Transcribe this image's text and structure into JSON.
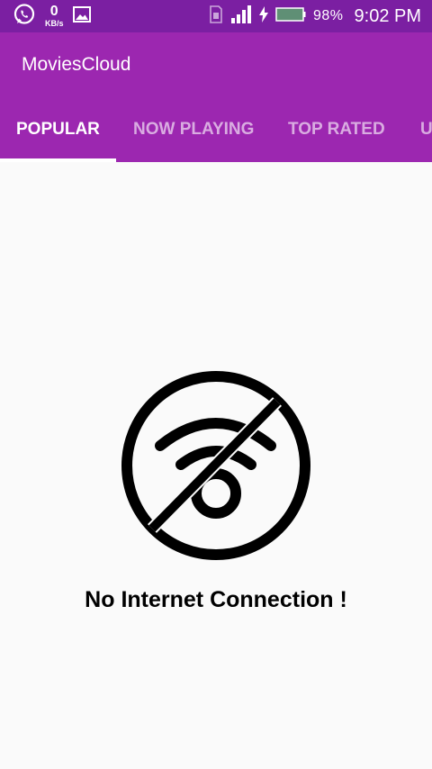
{
  "status_bar": {
    "data_rate": "0",
    "data_rate_unit": "KB/s",
    "battery_percent": "98%",
    "time": "9:02 PM",
    "icons": [
      "whatsapp-icon",
      "image-icon",
      "sim-icon",
      "signal-icon",
      "charging-icon",
      "battery-icon"
    ]
  },
  "app_bar": {
    "title": "MoviesCloud",
    "background": "#9c27b0"
  },
  "tabs": [
    {
      "label": "POPULAR",
      "active": true
    },
    {
      "label": "NOW PLAYING",
      "active": false
    },
    {
      "label": "TOP RATED",
      "active": false
    },
    {
      "label": "UPCOMING",
      "active": false
    }
  ],
  "main": {
    "icon": "no-wifi-icon",
    "message": "No Internet Connection !"
  }
}
